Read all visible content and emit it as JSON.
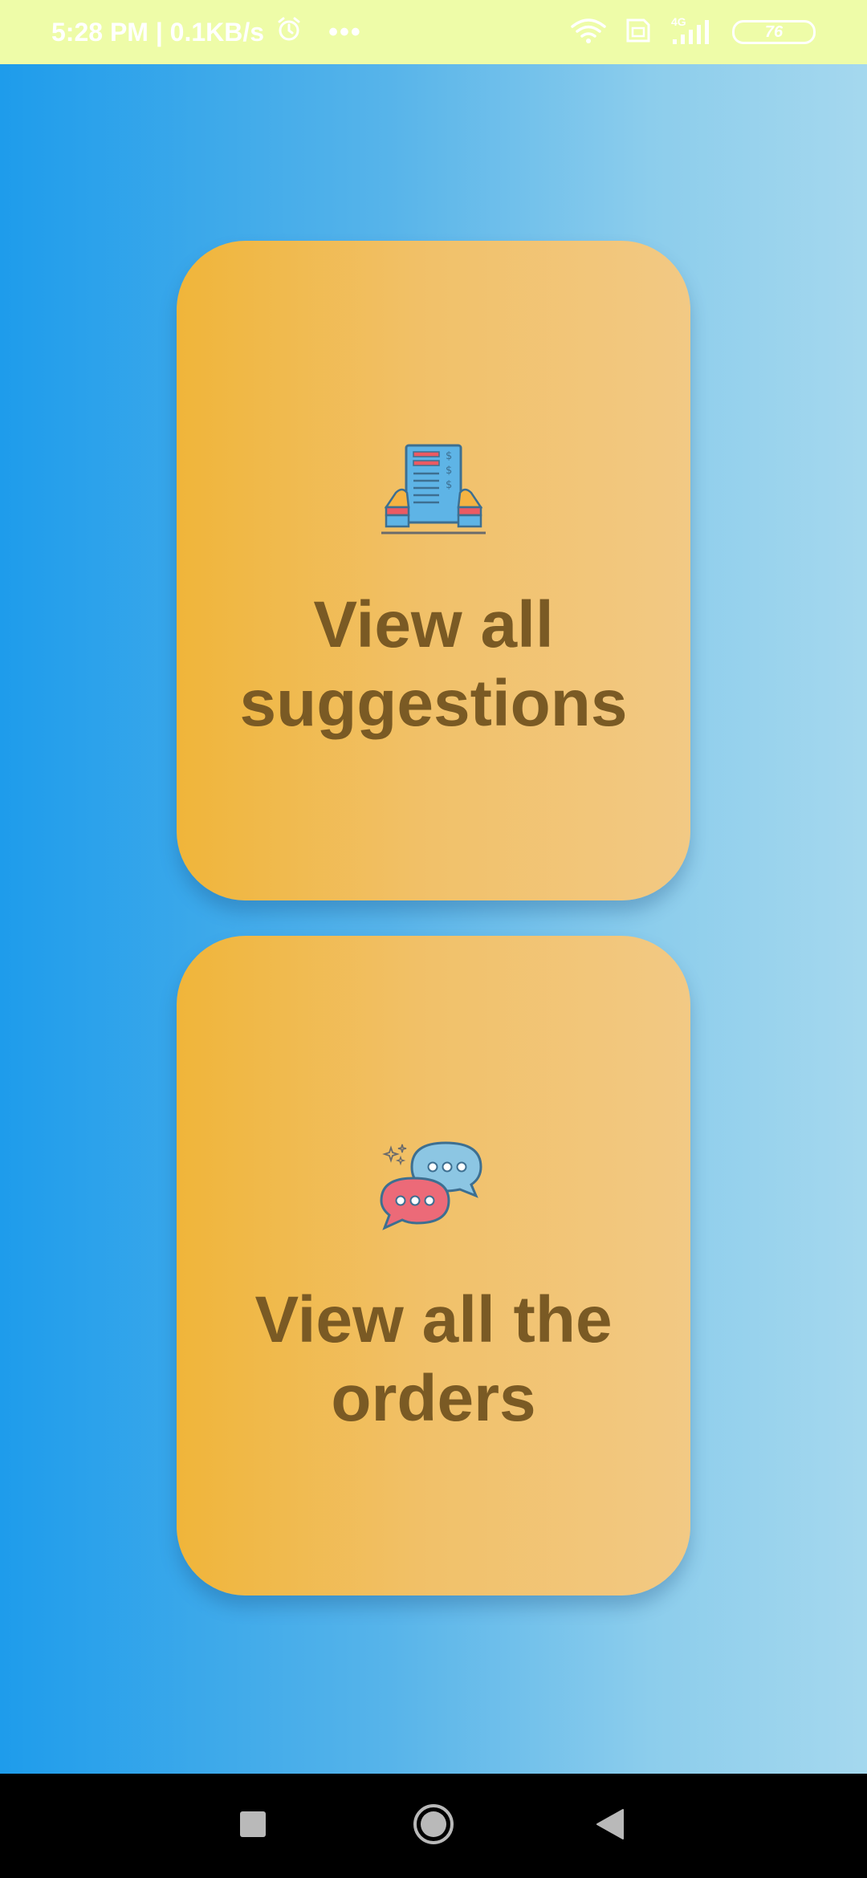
{
  "status_bar": {
    "time_speed": "5:28 PM | 0.1KB/s",
    "network_label": "4G",
    "battery_level": "76",
    "icons": [
      "alarm-icon",
      "more-dots-icon",
      "wifi-icon",
      "sim-icon",
      "signal-icon",
      "battery-icon"
    ]
  },
  "cards": [
    {
      "label": "View all\nsuggestions",
      "icon": "document-list-icon"
    },
    {
      "label": "View all the\norders",
      "icon": "chat-bubbles-icon"
    }
  ],
  "nav_bar": {
    "icons": [
      "recents-square-icon",
      "home-circle-icon",
      "back-triangle-icon"
    ]
  },
  "colors": {
    "status_bar_bg": "#eefca8",
    "background_start": "#1e9ceb",
    "background_end": "#a5d8ee",
    "card_start": "#f0b53a",
    "card_end": "#f2c984",
    "card_text": "#7a5a24"
  }
}
